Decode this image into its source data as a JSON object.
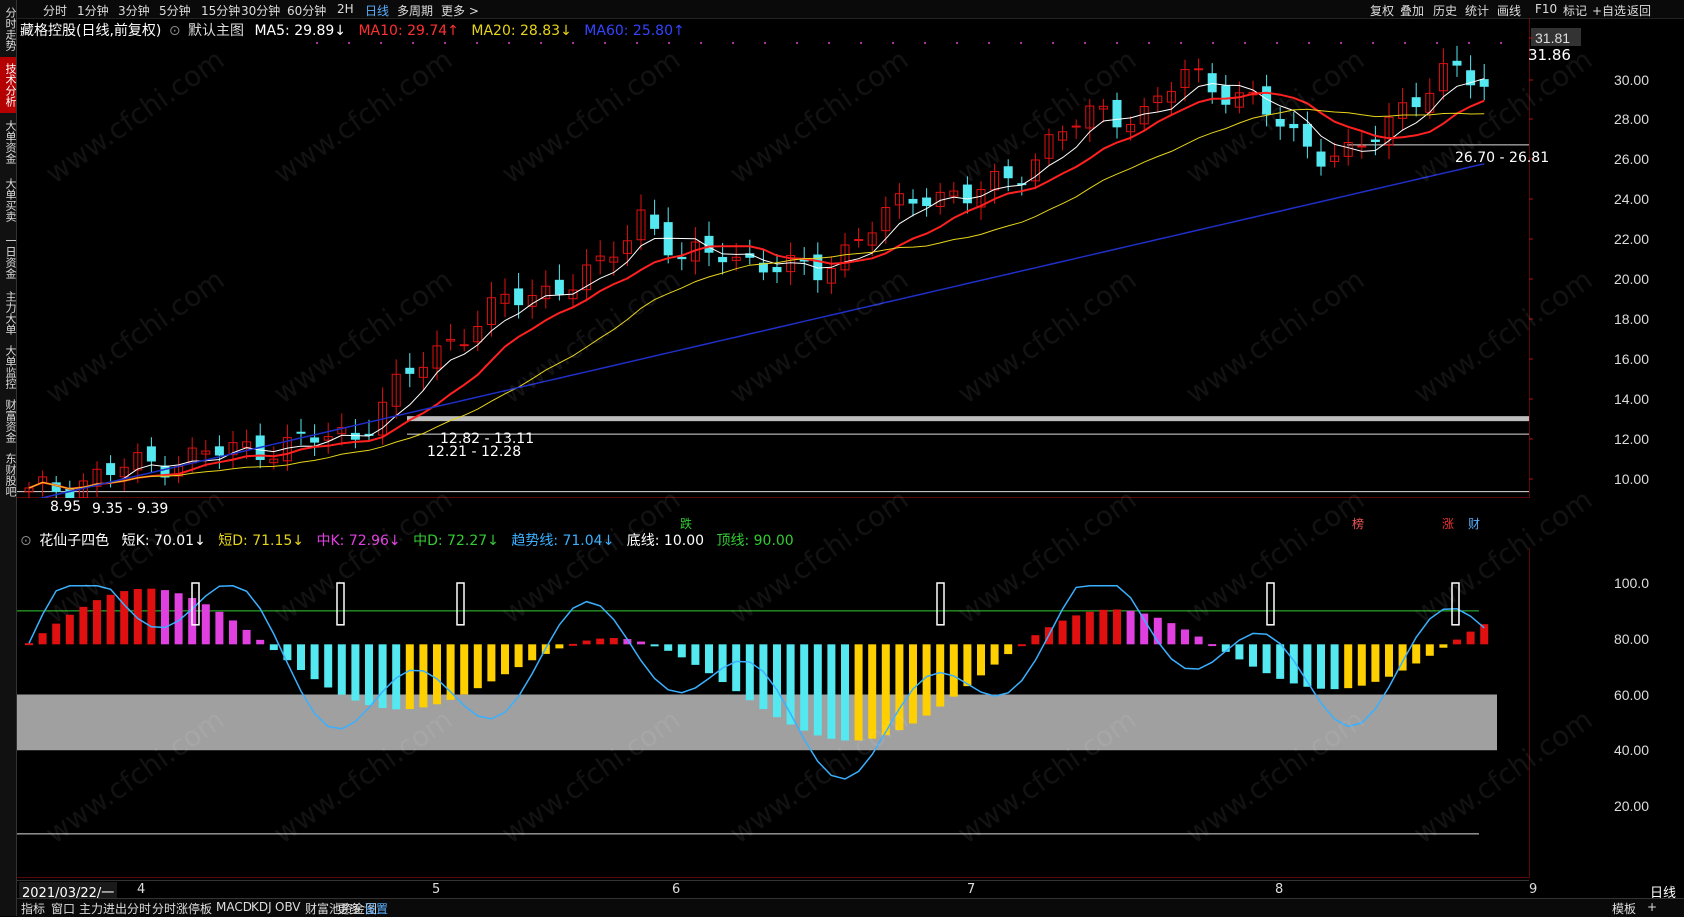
{
  "sidebar": [
    {
      "label": "分时走势",
      "active": false
    },
    {
      "label": "技术分析",
      "active": true
    },
    {
      "label": "大单资金",
      "active": false
    },
    {
      "label": "大单买卖",
      "active": false
    },
    {
      "label": "一日资金",
      "active": false
    },
    {
      "label": "主力大单",
      "active": false
    },
    {
      "label": "大单监控",
      "active": false
    },
    {
      "label": "财富资金",
      "active": false
    },
    {
      "label": "东财股吧",
      "active": false
    }
  ],
  "topbar": {
    "periods": [
      "分时",
      "1分钟",
      "3分钟",
      "5分钟",
      "15分钟",
      "30分钟",
      "60分钟",
      "2H",
      "日线",
      "多周期",
      "更多 >"
    ],
    "active_period": "日线",
    "right_tools": [
      "复权",
      "叠加",
      "历史",
      "统计",
      "画线",
      "F10",
      "标记",
      "+自选",
      "返回"
    ]
  },
  "main_legend": {
    "stock": "藏格控股(日线,前复权)",
    "chart_name": "默认主图",
    "ma5": "MA5: 29.89↓",
    "ma10": "MA10: 29.74↑",
    "ma20": "MA20: 28.83↓",
    "ma60": "MA60: 25.80↑"
  },
  "sub_legend": {
    "name": "花仙子四色",
    "k": "短K: 70.01↓",
    "d": "短D: 71.15↓",
    "mk": "中K: 72.96↓",
    "md": "中D: 72.27↓",
    "trend": "趋势线: 71.04↓",
    "bottom": "底线: 10.00",
    "top": "顶线: 90.00"
  },
  "price_axis": [
    "31.81",
    "30.00",
    "28.00",
    "26.00",
    "24.00",
    "22.00",
    "20.00",
    "18.00",
    "16.00",
    "14.00",
    "12.00",
    "10.00"
  ],
  "ind_axis": [
    "100.0",
    "80.00",
    "60.00",
    "40.00",
    "20.00"
  ],
  "annotations": {
    "high": "31.86",
    "range1": "26.70 - 26.81",
    "range2": "12.82 - 13.11",
    "range3": "12.21 - 12.28",
    "range4": "9.35 - 9.39",
    "low": "8.95"
  },
  "signals": [
    {
      "text": "跌",
      "color": "#3c3"
    },
    {
      "text": "榜",
      "color": "#e55"
    },
    {
      "text": "涨",
      "color": "#e33"
    },
    {
      "text": "财",
      "color": "#5ab0ff"
    }
  ],
  "date_axis": {
    "current": "2021/03/22/一",
    "months": [
      "4",
      "5",
      "6",
      "7",
      "8",
      "9"
    ]
  },
  "bottombar": {
    "items": [
      "指标",
      "窗口",
      "主力进出分时",
      "分时涨停板",
      "MACD",
      "KDJ",
      "OBV",
      "财富池资金图",
      "更多",
      "设置"
    ],
    "active": "设置",
    "right": [
      "模板",
      "+"
    ],
    "period": "日线"
  },
  "watermark": "www.cfchi.com",
  "colors": {
    "up": "#e01010",
    "down": "#54e8f0",
    "ma5": "#ffffff",
    "ma10": "#ff2020",
    "ma20": "#e6d41a",
    "ma60": "#1f2fc8"
  }
}
